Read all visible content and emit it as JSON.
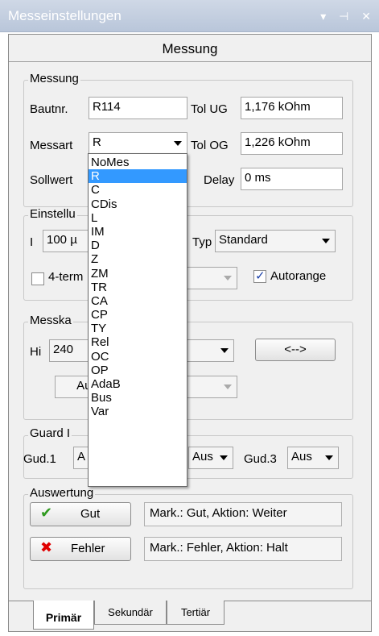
{
  "window": {
    "title": "Messeinstellungen",
    "controls": "▾ ⊣ ✕",
    "panel_header": "Messung"
  },
  "messung": {
    "legend": "Messung",
    "bautnr_label": "Bautnr.",
    "bautnr_value": "R114",
    "tolug_label": "Tol UG",
    "tolug_value": "1,176 kOhm",
    "messart_label": "Messart",
    "messart_value": "R",
    "tolog_label": "Tol OG",
    "tolog_value": "1,226 kOhm",
    "sollwert_label": "Sollwert",
    "delay_label": "Delay",
    "delay_value": "0 ms"
  },
  "messart_dropdown": {
    "options": [
      "NoMes",
      "R",
      "C",
      "CDis",
      "L",
      "IM",
      "D",
      "Z",
      "ZM",
      "TR",
      "CA",
      "CP",
      "TY",
      "Rel",
      "OC",
      "OP",
      "AdaB",
      "Bus",
      "Var"
    ],
    "selected_index": 1
  },
  "einstellung": {
    "legend": "Einstellu",
    "i_label": "I",
    "i_value": "100 µ",
    "typ_label": "Typ",
    "typ_value": "Standard",
    "fourterm_label": "4-term",
    "fourterm_checked": false,
    "autorange_label": "Autorange",
    "autorange_checked": true
  },
  "messkanal": {
    "legend": "Messka",
    "hi_label": "Hi",
    "hi_value": "240",
    "swap_label": "<-->",
    "aus_label": "Aus",
    "s_fragment": "s"
  },
  "guard": {
    "legend": "Guard I",
    "gud1_label": "Gud.1",
    "gud1_value": "A",
    "gud2_value": "Aus",
    "gud3_label": "Gud.3",
    "gud3_value": "Aus"
  },
  "auswertung": {
    "legend": "Auswertung",
    "gut_label": "Gut",
    "gut_info": "Mark.: Gut, Aktion: Weiter",
    "fehler_label": "Fehler",
    "fehler_info": "Mark.: Fehler, Aktion: Halt",
    "gut_icon_color": "#2f9a1f",
    "fehler_icon_color": "#e00000"
  },
  "tabs": [
    "Primär",
    "Sekundär",
    "Tertiär"
  ],
  "colors": {
    "selection": "#3399ff",
    "titlebar": "#c3cfe0"
  }
}
